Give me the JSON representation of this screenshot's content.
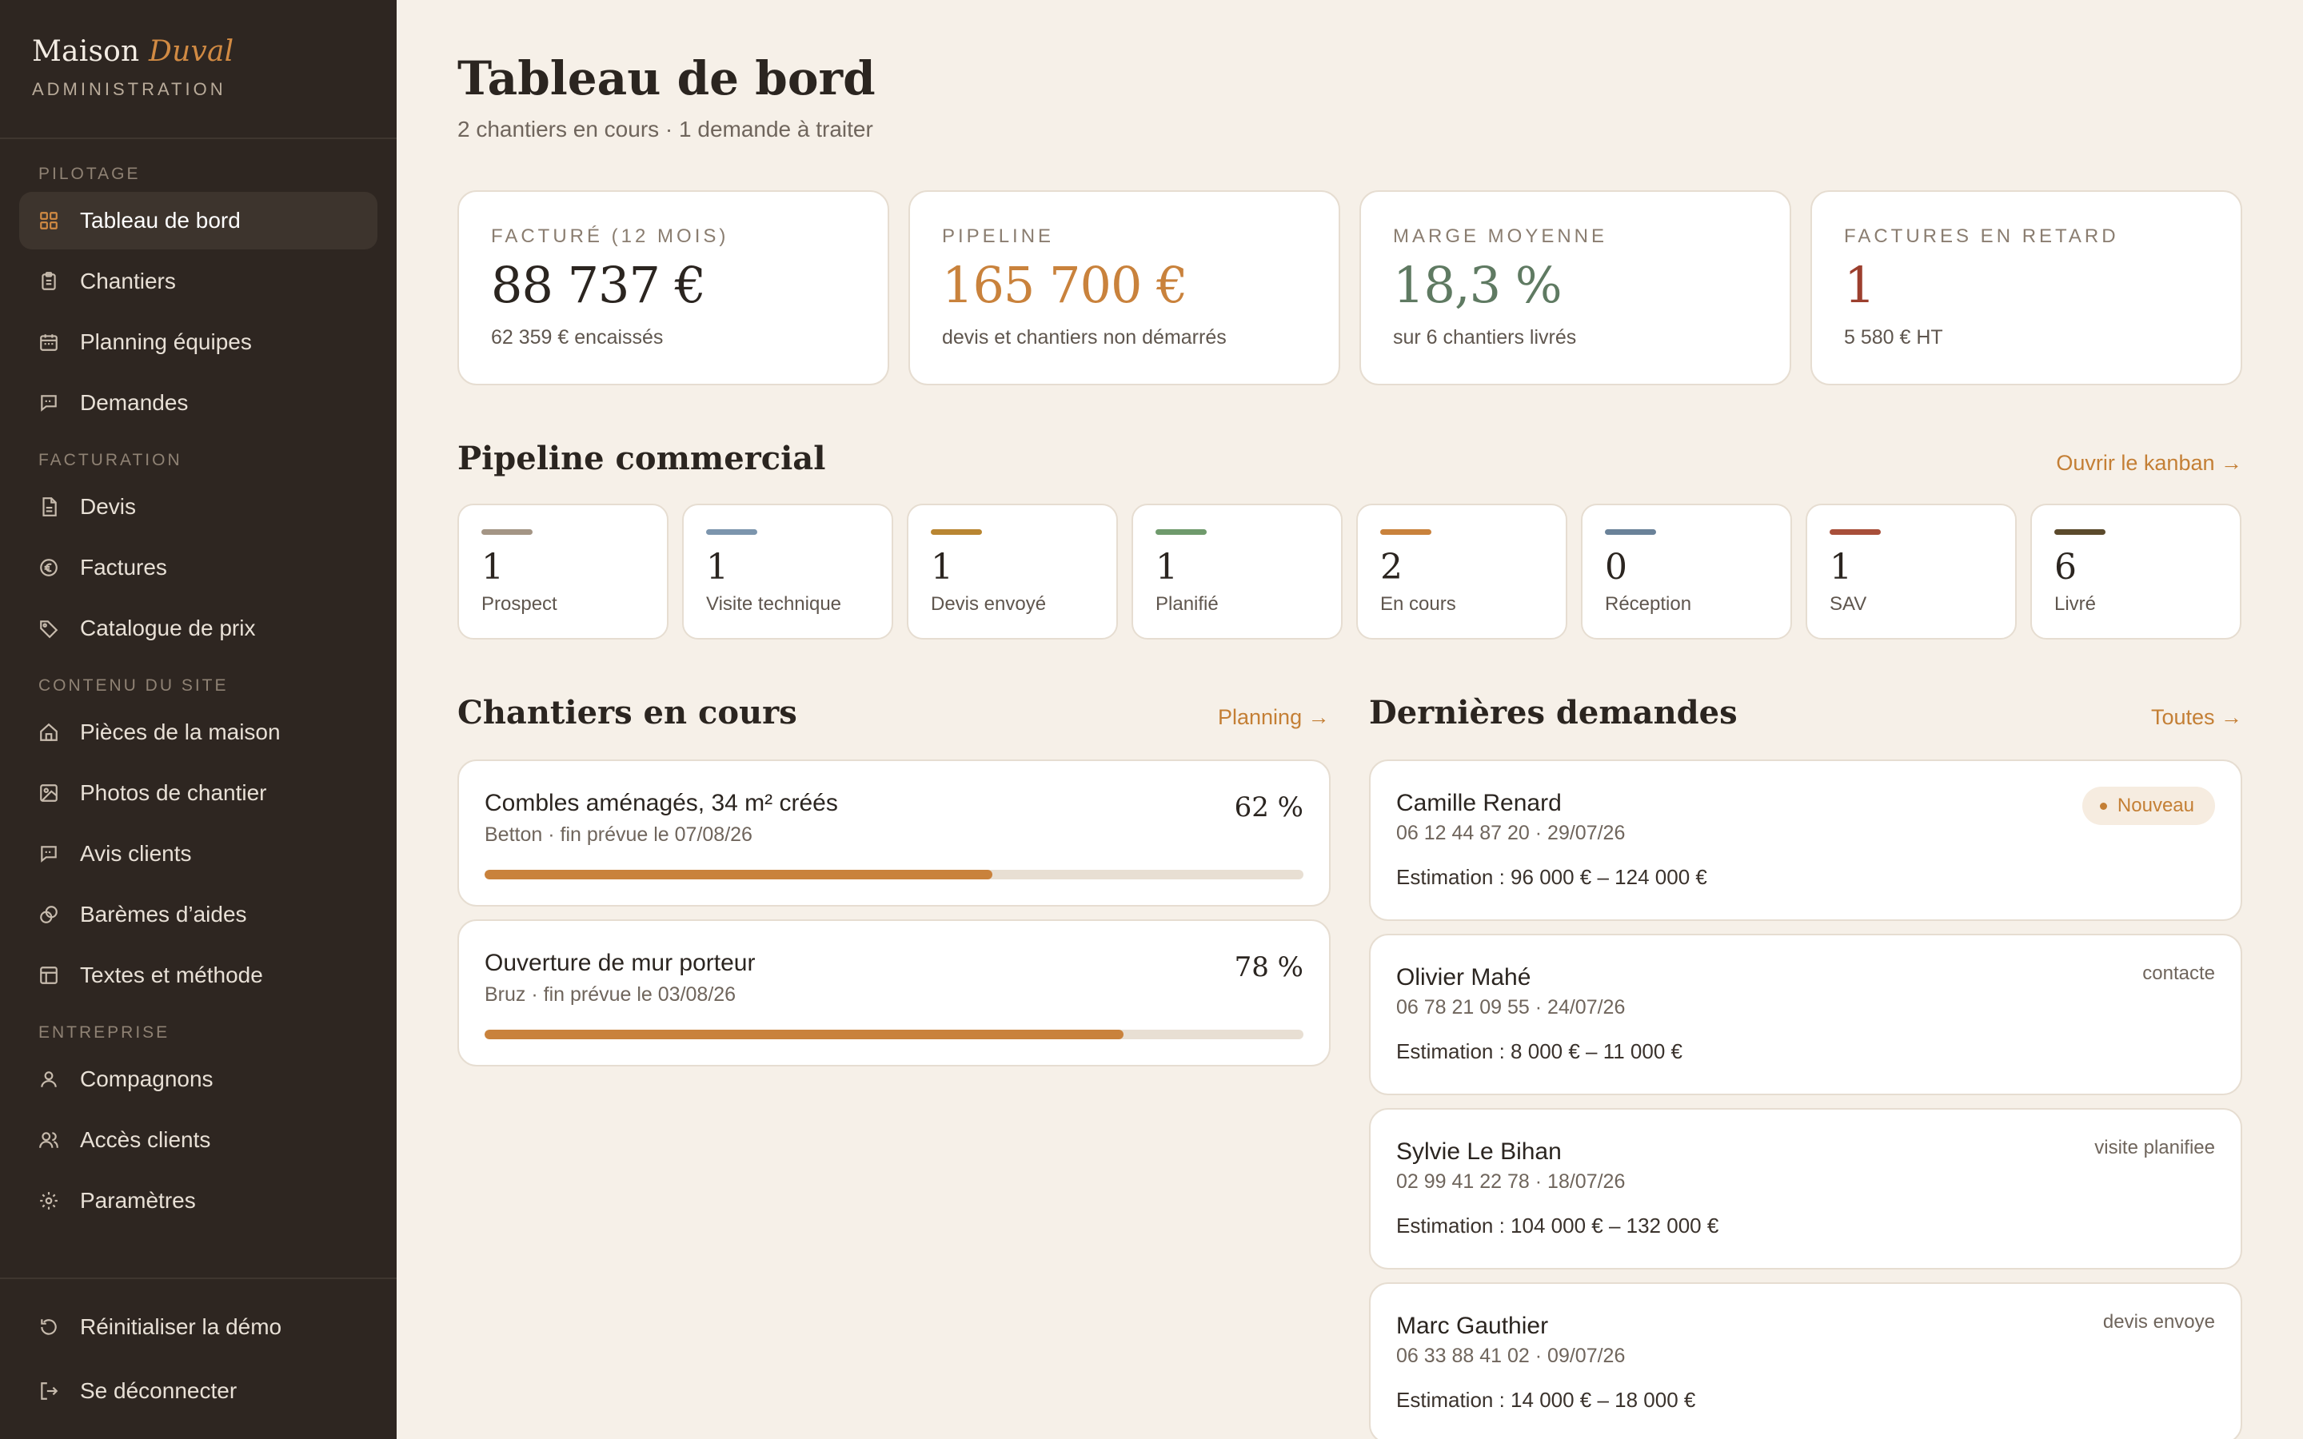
{
  "brand": {
    "name_main": "Maison",
    "name_accent": "Duval",
    "subtitle": "ADMINISTRATION"
  },
  "sidebar": {
    "sections": [
      {
        "title": "PILOTAGE",
        "items": [
          {
            "label": "Tableau de bord",
            "icon": "grid-icon",
            "active": true
          },
          {
            "label": "Chantiers",
            "icon": "clipboard-icon"
          },
          {
            "label": "Planning équipes",
            "icon": "calendar-icon"
          },
          {
            "label": "Demandes",
            "icon": "message-icon"
          }
        ]
      },
      {
        "title": "FACTURATION",
        "items": [
          {
            "label": "Devis",
            "icon": "document-icon"
          },
          {
            "label": "Factures",
            "icon": "euro-icon"
          },
          {
            "label": "Catalogue de prix",
            "icon": "tag-icon"
          }
        ]
      },
      {
        "title": "CONTENU DU SITE",
        "items": [
          {
            "label": "Pièces de la maison",
            "icon": "home-icon"
          },
          {
            "label": "Photos de chantier",
            "icon": "image-icon"
          },
          {
            "label": "Avis clients",
            "icon": "message-icon"
          },
          {
            "label": "Barèmes d’aides",
            "icon": "coins-icon"
          },
          {
            "label": "Textes et méthode",
            "icon": "layout-icon"
          }
        ]
      },
      {
        "title": "ENTREPRISE",
        "items": [
          {
            "label": "Compagnons",
            "icon": "user-icon"
          },
          {
            "label": "Accès clients",
            "icon": "users-icon"
          },
          {
            "label": "Paramètres",
            "icon": "gear-icon"
          }
        ]
      }
    ],
    "bottom": {
      "reset_label": "Réinitialiser la démo",
      "logout_label": "Se déconnecter"
    }
  },
  "header": {
    "title": "Tableau de bord",
    "subtitle": "2 chantiers en cours · 1 demande à traiter"
  },
  "kpis": [
    {
      "label": "FACTURÉ (12 MOIS)",
      "value": "88 737 €",
      "note": "62 359 € encaissés",
      "color": "#2b2520"
    },
    {
      "label": "PIPELINE",
      "value": "165 700 €",
      "note": "devis et chantiers non démarrés",
      "color": "#c9823c"
    },
    {
      "label": "MARGE MOYENNE",
      "value": "18,3 %",
      "note": "sur 6 chantiers livrés",
      "color": "#5f7a62"
    },
    {
      "label": "FACTURES EN RETARD",
      "value": "1",
      "note": "5 580 € HT",
      "color": "#9c3f2e"
    }
  ],
  "pipeline": {
    "title": "Pipeline commercial",
    "link": "Ouvrir le kanban →",
    "stages": [
      {
        "count": "1",
        "label": "Prospect",
        "color": "#a49585"
      },
      {
        "count": "1",
        "label": "Visite technique",
        "color": "#7c95ad"
      },
      {
        "count": "1",
        "label": "Devis envoyé",
        "color": "#b98632"
      },
      {
        "count": "1",
        "label": "Planifié",
        "color": "#6f9a6c"
      },
      {
        "count": "2",
        "label": "En cours",
        "color": "#c9823c"
      },
      {
        "count": "0",
        "label": "Réception",
        "color": "#6a8299"
      },
      {
        "count": "1",
        "label": "SAV",
        "color": "#a84f3a"
      },
      {
        "count": "6",
        "label": "Livré",
        "color": "#5b4a2c"
      }
    ]
  },
  "projects": {
    "title": "Chantiers en cours",
    "link": "Planning →",
    "items": [
      {
        "title": "Combles aménagés, 34 m² créés",
        "meta": "Betton · fin prévue le 07/08/26",
        "pct_label": "62 %",
        "progress": 0.62
      },
      {
        "title": "Ouverture de mur porteur",
        "meta": "Bruz · fin prévue le 03/08/26",
        "pct_label": "78 %",
        "progress": 0.78
      }
    ]
  },
  "requests": {
    "title": "Dernières demandes",
    "link": "Toutes →",
    "items": [
      {
        "name": "Camille Renard",
        "meta": "06 12 44 87 20 · 29/07/26",
        "estimate": "Estimation : 96 000 € – 124 000 €",
        "status": "Nouveau",
        "badge": true
      },
      {
        "name": "Olivier Mahé",
        "meta": "06 78 21 09 55 · 24/07/26",
        "estimate": "Estimation : 8 000 € – 11 000 €",
        "status": "contacte",
        "badge": false
      },
      {
        "name": "Sylvie Le Bihan",
        "meta": "02 99 41 22 78 · 18/07/26",
        "estimate": "Estimation : 104 000 € – 132 000 €",
        "status": "visite planifiee",
        "badge": false
      },
      {
        "name": "Marc Gauthier",
        "meta": "06 33 88 41 02 · 09/07/26",
        "estimate": "Estimation : 14 000 € – 18 000 €",
        "status": "devis envoye",
        "badge": false
      }
    ]
  }
}
